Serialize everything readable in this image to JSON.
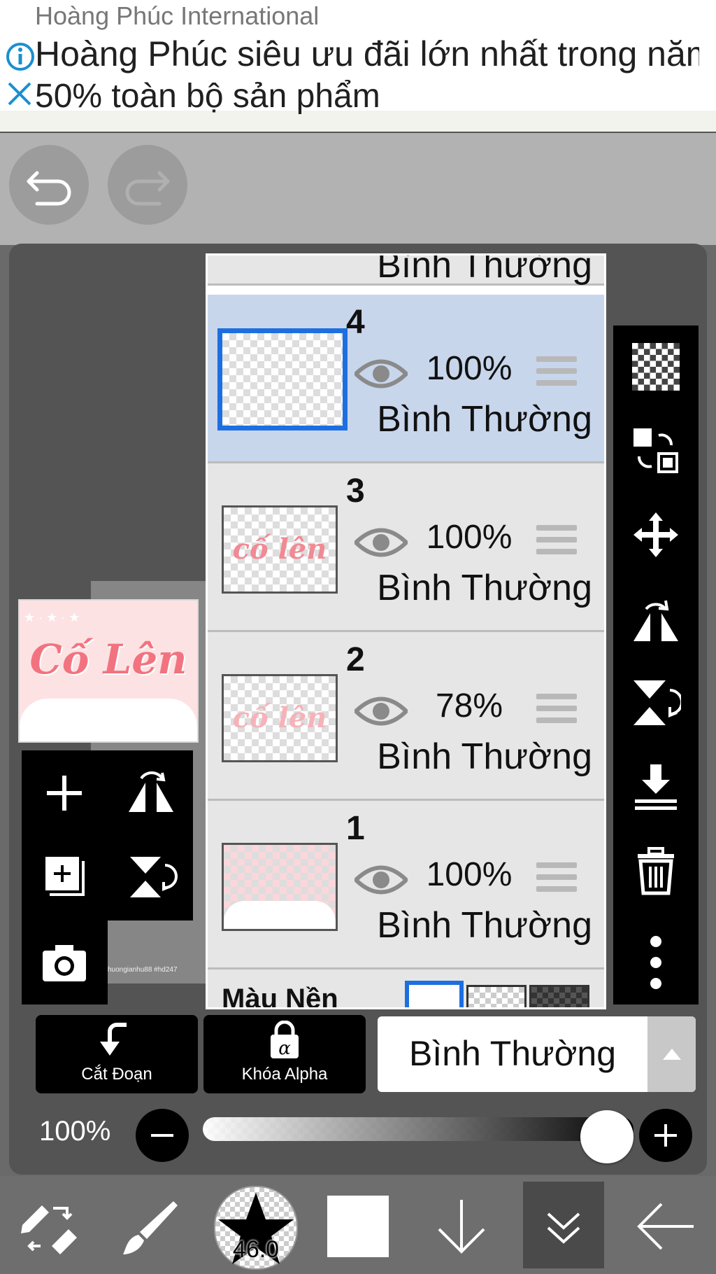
{
  "ad": {
    "source": "Hoàng Phúc International",
    "headline": "Hoàng Phúc siêu ưu đãi lớn nhất trong năm",
    "subline": "50% toàn bộ sản phẩm",
    "info_icon": "info-icon",
    "close_icon": "close-icon"
  },
  "history": {
    "undo_icon": "undo-icon",
    "redo_icon": "redo-icon"
  },
  "preview": {
    "text": "Cố Lên",
    "watermark": "huongianhu88 #hd247"
  },
  "panel": {
    "top_partial_mode": "Bình Thường",
    "layers": [
      {
        "number": "4",
        "opacity": "100%",
        "mode": "Bình Thường",
        "selected": true,
        "thumb_text": ""
      },
      {
        "number": "3",
        "opacity": "100%",
        "mode": "Bình Thường",
        "selected": false,
        "thumb_text": "cố lên"
      },
      {
        "number": "2",
        "opacity": "78%",
        "mode": "Bình Thường",
        "selected": false,
        "thumb_text": "cố lên"
      },
      {
        "number": "1",
        "opacity": "100%",
        "mode": "Bình Thường",
        "selected": false,
        "thumb_text": ""
      }
    ],
    "background_label": "Màu Nền"
  },
  "controls": {
    "clip_label": "Cắt Đoạn",
    "alpha_lock_label": "Khóa Alpha",
    "blend_mode": "Bình Thường",
    "opacity_label": "100%",
    "opacity_value": 1.0
  },
  "bottom_nav": {
    "brush_size": "46.0"
  },
  "colors": {
    "selection": "#1d6fe0",
    "selected_row": "#c8d6ec",
    "thumb_pink": "#f08a94"
  }
}
